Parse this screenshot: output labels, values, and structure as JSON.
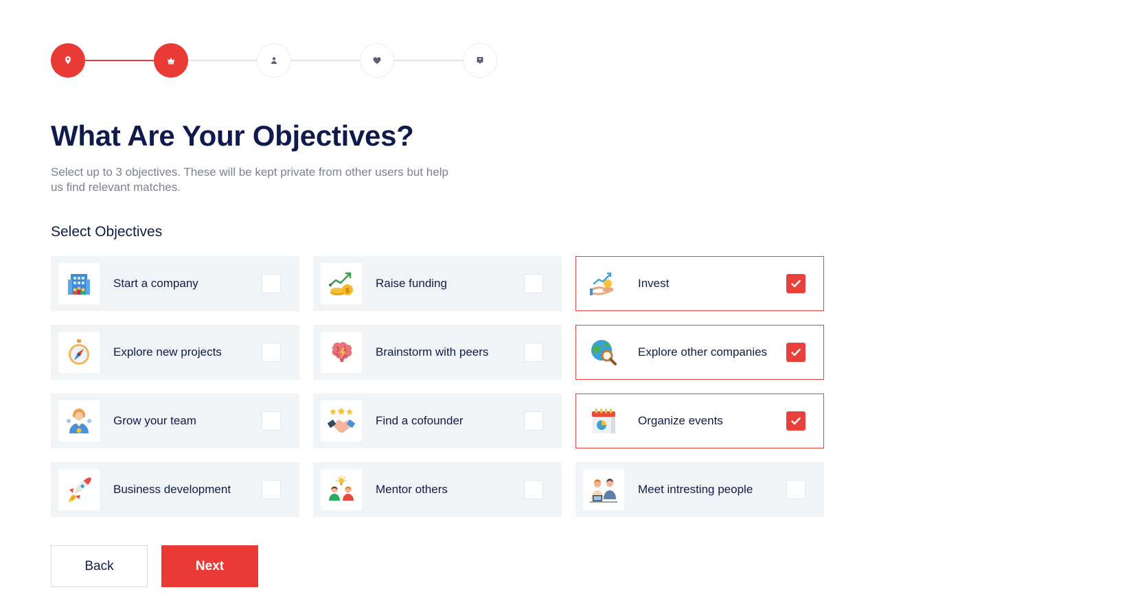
{
  "stepper": {
    "steps": [
      {
        "icon": "location-pin-icon",
        "state": "active"
      },
      {
        "icon": "crown-icon",
        "state": "active"
      },
      {
        "icon": "person-icon",
        "state": "inactive"
      },
      {
        "icon": "heart-icon",
        "state": "inactive"
      },
      {
        "icon": "badge-icon",
        "state": "inactive"
      }
    ]
  },
  "page": {
    "title": "What Are Your Objectives?",
    "subtitle": "Select up to 3 objectives. These will be kept private from other users but help us find relevant matches.",
    "section_title": "Select Objectives"
  },
  "objectives": [
    {
      "label": "Start a company",
      "icon": "office-building-icon",
      "checked": false
    },
    {
      "label": "Raise funding",
      "icon": "funding-growth-icon",
      "checked": false
    },
    {
      "label": "Invest",
      "icon": "investment-hand-icon",
      "checked": true
    },
    {
      "label": "Explore new projects",
      "icon": "compass-icon",
      "checked": false
    },
    {
      "label": "Brainstorm with peers",
      "icon": "brain-icon",
      "checked": false
    },
    {
      "label": "Explore other companies",
      "icon": "globe-search-icon",
      "checked": true
    },
    {
      "label": "Grow your team",
      "icon": "team-member-icon",
      "checked": false
    },
    {
      "label": "Find a cofounder",
      "icon": "handshake-icon",
      "checked": false
    },
    {
      "label": "Organize events",
      "icon": "calendar-icon",
      "checked": true
    },
    {
      "label": "Business development",
      "icon": "rocket-icon",
      "checked": false
    },
    {
      "label": "Mentor others",
      "icon": "mentor-icon",
      "checked": false
    },
    {
      "label": "Meet intresting people",
      "icon": "people-meeting-icon",
      "checked": false
    }
  ],
  "buttons": {
    "back": "Back",
    "next": "Next"
  },
  "colors": {
    "accent": "#ea3a35",
    "heading": "#0f1b4c",
    "muted_text": "#7b8193",
    "card_bg": "#f1f4f7"
  }
}
